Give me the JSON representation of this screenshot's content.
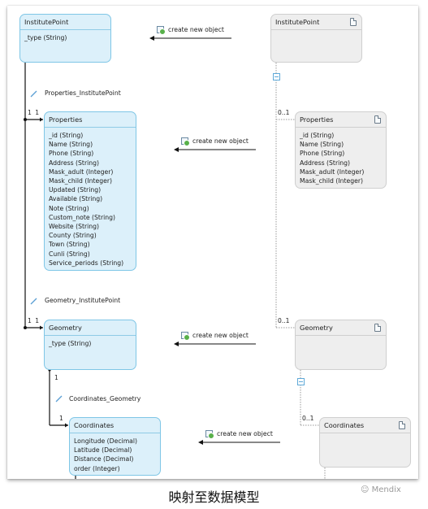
{
  "source_model": {
    "entities": [
      {
        "name": "InstitutePoint",
        "attributes": [
          "_type (String)"
        ]
      },
      {
        "name": "Properties",
        "attributes": [
          "_id (String)",
          "Name (String)",
          "Phone (String)",
          "Address (String)",
          "Mask_adult (Integer)",
          "Mask_child (Integer)",
          "Updated (String)",
          "Available (String)",
          "Note (String)",
          "Custom_note (String)",
          "Website (String)",
          "County (String)",
          "Town (String)",
          "Cunli (String)",
          "Service_periods (String)"
        ]
      },
      {
        "name": "Geometry",
        "attributes": [
          "_type (String)"
        ]
      },
      {
        "name": "Coordinates",
        "attributes": [
          "Longitude (Decimal)",
          "Latitude (Decimal)",
          "Distance (Decimal)",
          "order (Integer)"
        ]
      }
    ],
    "associations": [
      {
        "name": "Properties_InstitutePoint",
        "multiplicity": "1  1"
      },
      {
        "name": "Geometry_InstitutePoint",
        "multiplicity": "1  1"
      },
      {
        "name": "Coordinates_Geometry",
        "multiplicity_parent": "1",
        "multiplicity_child": "1"
      }
    ]
  },
  "mapping_model": {
    "entities": [
      {
        "name": "InstitutePoint",
        "attributes": []
      },
      {
        "name": "Properties",
        "attributes": [
          "_id (String)",
          "Name (String)",
          "Phone (String)",
          "Address (String)",
          "Mask_adult (Integer)",
          "Mask_child (Integer)"
        ],
        "multiplicity": "0..1"
      },
      {
        "name": "Geometry",
        "attributes": [],
        "multiplicity": "0..1"
      },
      {
        "name": "Coordinates",
        "attributes": [],
        "multiplicity": "0..1"
      }
    ]
  },
  "arrows": [
    {
      "label": "create new object"
    },
    {
      "label": "create new object"
    },
    {
      "label": "create new object"
    },
    {
      "label": "create new object"
    }
  ],
  "caption": "映射至数据模型",
  "watermark": "Mendix"
}
